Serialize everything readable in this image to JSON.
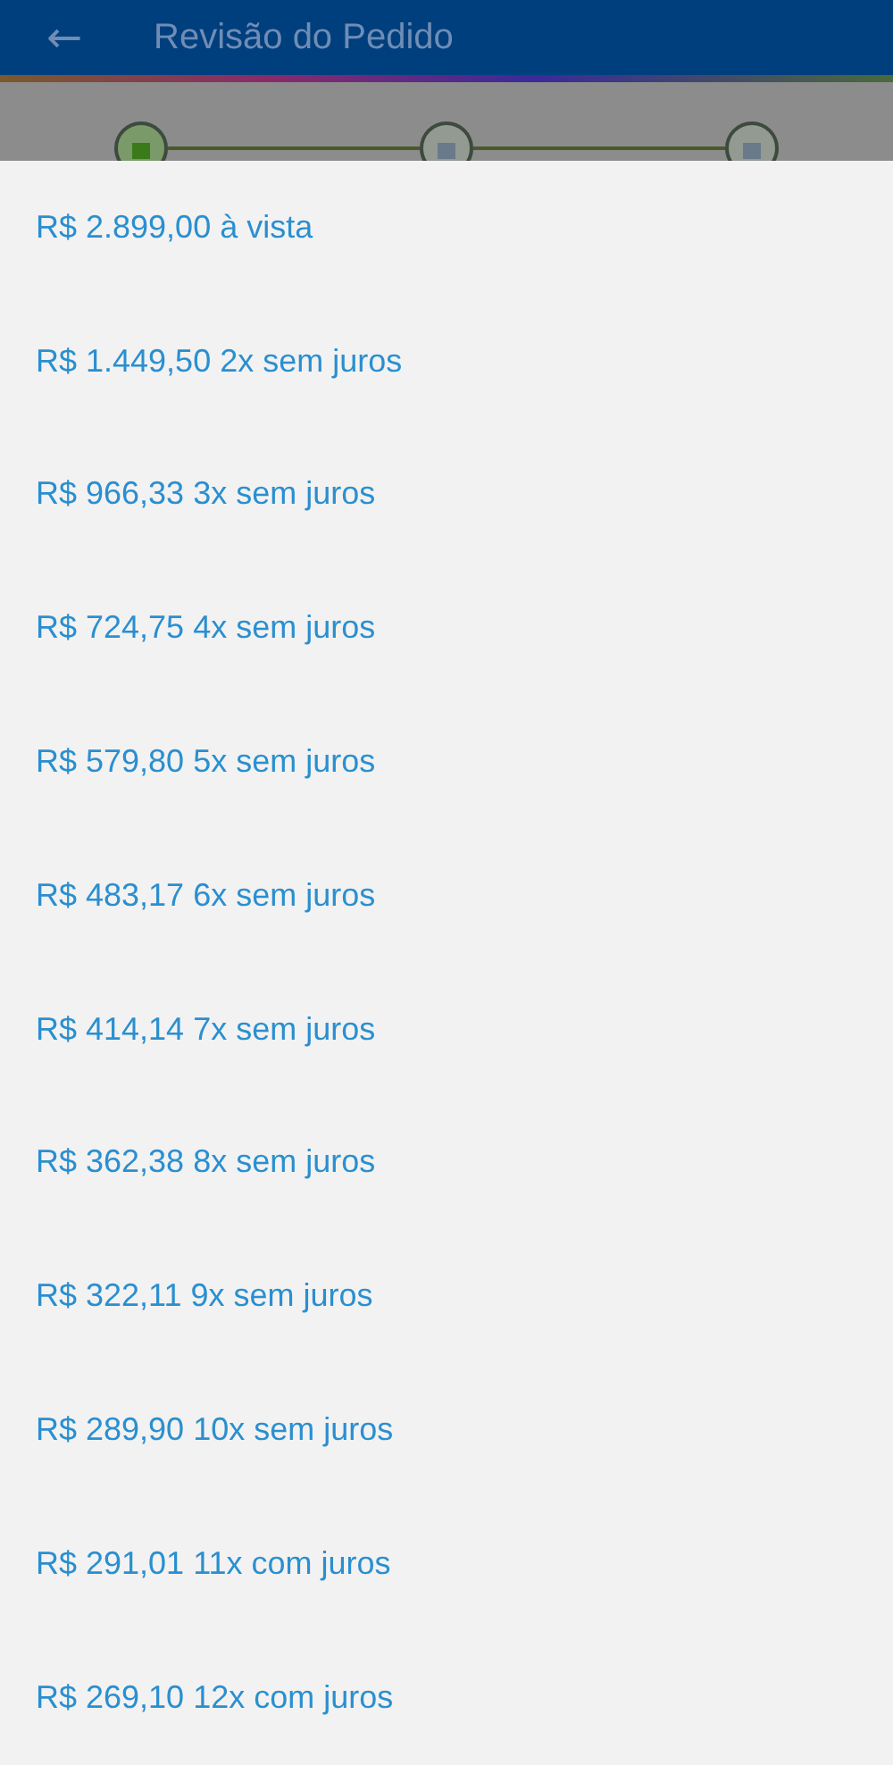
{
  "header": {
    "back_icon": "←",
    "title": "Revisão do Pedido"
  },
  "stepper": {
    "steps": [
      {
        "done": true
      },
      {
        "done": false
      },
      {
        "done": false
      }
    ]
  },
  "options": [
    {
      "label": "R$ 2.899,00 à vista"
    },
    {
      "label": "R$ 1.449,50 2x sem juros"
    },
    {
      "label": "R$ 966,33 3x sem juros"
    },
    {
      "label": "R$ 724,75 4x sem juros"
    },
    {
      "label": "R$ 579,80 5x sem juros"
    },
    {
      "label": "R$ 483,17 6x sem juros"
    },
    {
      "label": "R$ 414,14 7x sem juros"
    },
    {
      "label": "R$ 362,38 8x sem juros"
    },
    {
      "label": "R$ 322,11 9x sem juros"
    },
    {
      "label": "R$ 289,90 10x sem juros"
    },
    {
      "label": "R$ 291,01 11x com juros"
    },
    {
      "label": "R$ 269,10 12x com juros"
    }
  ]
}
